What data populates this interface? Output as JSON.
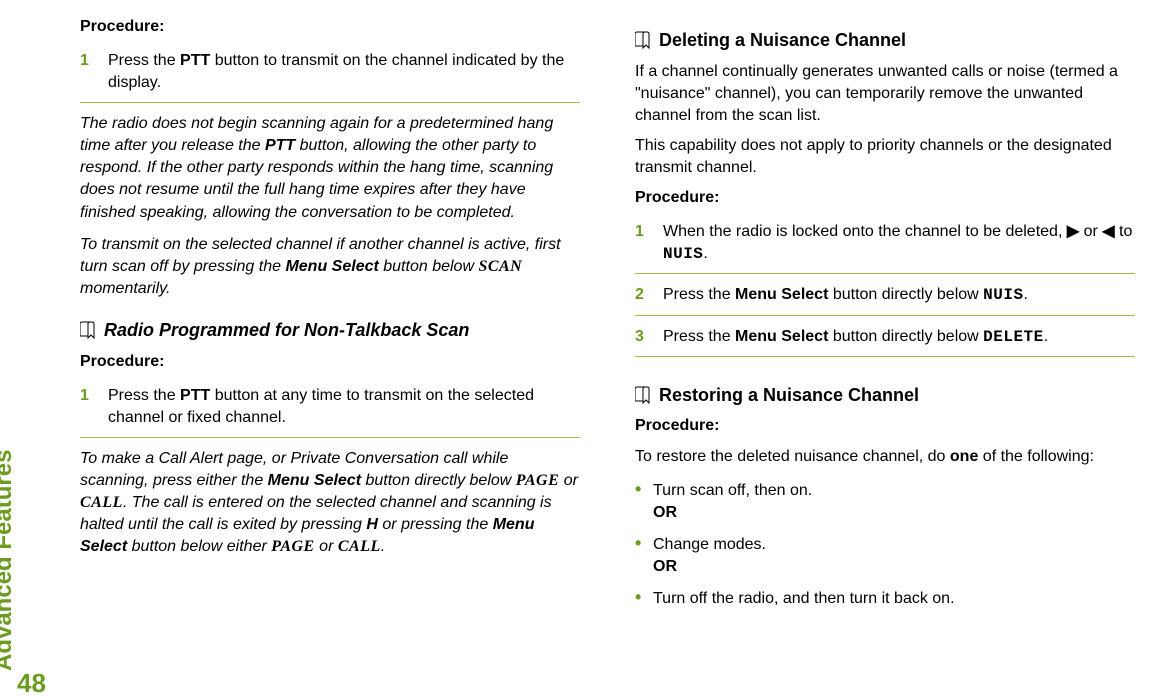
{
  "sideTab": "Advanced Features",
  "pageNum": "48",
  "left": {
    "procedureLabel1": "Procedure",
    "procedureColon": ":",
    "step1a": "Press the ",
    "step1b": "PTT",
    "step1c": " button to transmit on the channel indicated by the display.",
    "italPara1a": "The radio does not begin scanning again for a predetermined hang time after you release the ",
    "italPara1b": "PTT",
    "italPara1c": " button, allowing the other party to respond. If the other party responds within the hang time, scanning does not resume until the full hang time expires after they have finished speaking, allowing the conversation to be completed.",
    "italPara2a": "To transmit on the selected channel if another channel is active, first turn scan off by pressing the ",
    "italPara2b": "Menu Select",
    "italPara2c": " button below ",
    "italPara2d": "SCAN",
    "italPara2e": " momentarily.",
    "heading2": "Radio Programmed for Non-Talkback Scan",
    "procedureLabel2": "Procedure:",
    "step2a": "Press the ",
    "step2b": "PTT",
    "step2c": " button at any time to transmit on the selected channel or fixed channel.",
    "italPara3a": "To make a Call Alert page, or Private Conversation call while scanning, press either the ",
    "italPara3b": "Menu Select",
    "italPara3c": " button directly below ",
    "italPara3d": "PAGE",
    "italPara3e": " or ",
    "italPara3f": "CALL",
    "italPara3g": ". The call is entered on the selected channel and scanning is halted until the call is exited by pressing ",
    "italPara3h": "H",
    "italPara3i": " or pressing the ",
    "italPara3j": "Menu Select",
    "italPara3k": " button below either ",
    "italPara3l": "PAGE",
    "italPara3m": " or ",
    "italPara3n": "CALL",
    "italPara3o": "."
  },
  "right": {
    "heading1": "Deleting a Nuisance Channel",
    "para1": "If a channel continually generates unwanted calls or noise (termed a \"nuisance\" channel), you can temporarily remove the unwanted channel from the scan list.",
    "para2": "This capability does not apply to priority channels or the designated transmit channel.",
    "procedureLabel": "Procedure:",
    "s1a": "When the radio is locked onto the channel to be deleted, ",
    "s1arrow1": "▶",
    "s1or": " or ",
    "s1arrow2": "◀",
    "s1to": " to ",
    "s1nuis": "NUIS",
    "s1dot": ".",
    "s2a": "Press the ",
    "s2b": "Menu Select",
    "s2c": " button directly below ",
    "s2d": "NUIS",
    "s2e": ".",
    "s3a": "Press the ",
    "s3b": "Menu Select",
    "s3c": " button directly below ",
    "s3d": "DELETE",
    "s3e": ".",
    "heading2": "Restoring a Nuisance Channel",
    "procedureLabel2": "Procedure:",
    "restoreIntroA": "To restore the deleted nuisance channel, do ",
    "restoreIntroB": "one",
    "restoreIntroC": " of the following:",
    "b1": "Turn scan off, then on.",
    "or": "OR",
    "b2": "Change modes.",
    "b3": "Turn off the radio, and then turn it back on."
  }
}
